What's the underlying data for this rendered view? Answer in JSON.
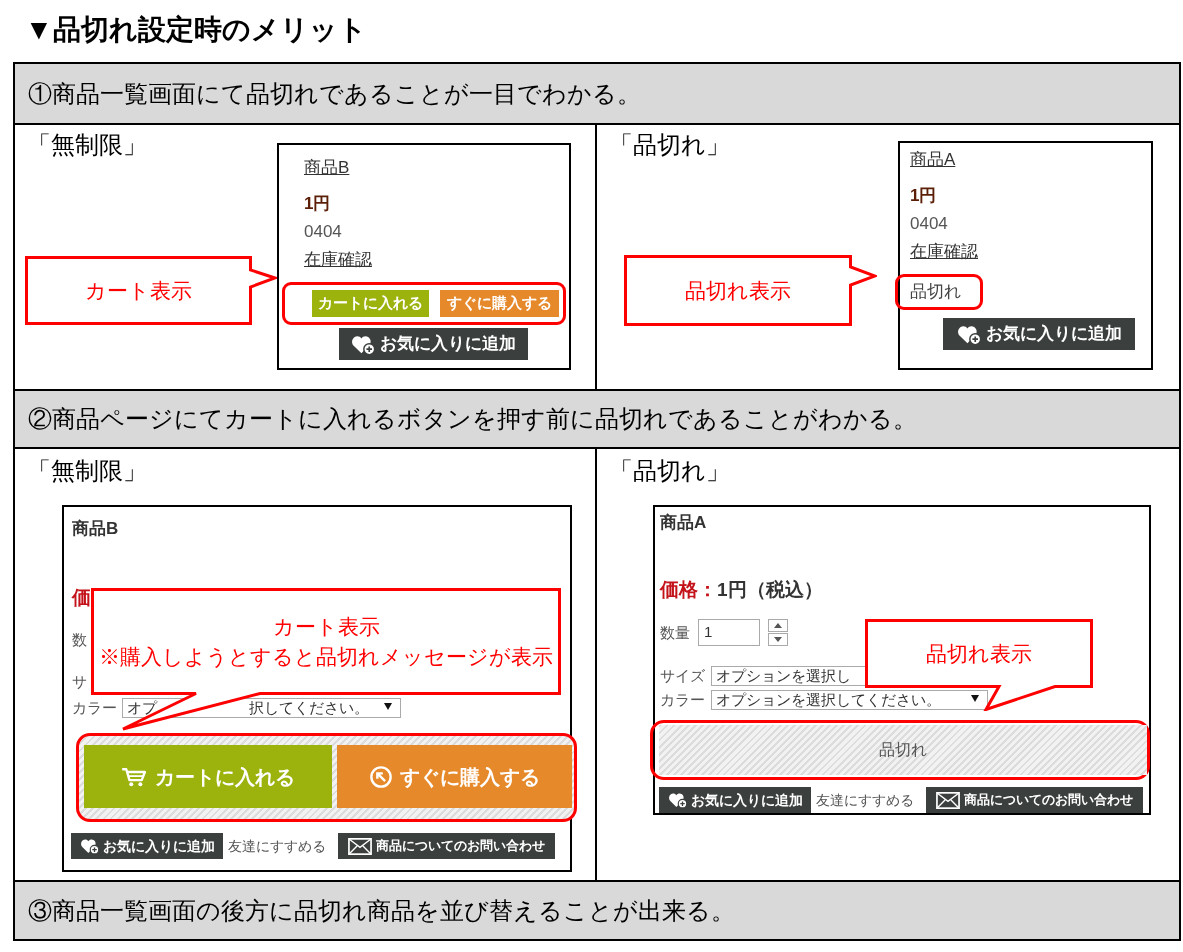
{
  "title": "▼品切れ設定時のメリット",
  "sections": [
    {
      "kind": "list_view",
      "heading": "①商品一覧画面にて品切れであることが一目でわかる。",
      "panels": [
        {
          "kind": "in_stock",
          "label": "「無制限」",
          "product": {
            "name": "商品B",
            "price": "1円",
            "code": "0404",
            "stock_link": "在庫確認",
            "cart_button": "カートに入れる",
            "buy_button": "すぐに購入する",
            "favorite_button": "お気に入りに追加"
          },
          "callout": [
            "カート表示"
          ]
        },
        {
          "kind": "sold_out",
          "label": "「品切れ」",
          "product": {
            "name": "商品A",
            "price": "1円",
            "code": "0404",
            "stock_link": "在庫確認",
            "sold_out": "品切れ",
            "favorite_button": "お気に入りに追加"
          },
          "callout": [
            "品切れ表示"
          ]
        }
      ]
    },
    {
      "kind": "product_page",
      "heading": "②商品ページにてカートに入れるボタンを押す前に品切れであることがわかる。",
      "panels": [
        {
          "kind": "in_stock",
          "label": "「無制限」",
          "product": {
            "name": "商品B",
            "price_label": "価",
            "quantity_label": "数",
            "size_label": "サ",
            "color_label": "カラー",
            "color_select": [
              "オプ",
              "択してください。"
            ],
            "cart_button": "カートに入れる",
            "buy_button": "すぐに購入する",
            "favorite_button": "お気に入りに追加",
            "recommend_link": "友達にすすめる",
            "inquiry_button": "商品についてのお問い合わせ"
          },
          "callout": [
            "カート表示",
            "※購入しようとすると品切れメッセージが表示"
          ]
        },
        {
          "kind": "sold_out",
          "label": "「品切れ」",
          "product": {
            "name": "商品A",
            "price_label": "価格：",
            "price_value": "1円（税込）",
            "quantity_label": "数量",
            "quantity_value": "1",
            "size_label": "サイズ",
            "size_select": [
              "オプションを選択し"
            ],
            "color_label": "カラー",
            "color_select": [
              "オプションを選択してください。"
            ],
            "sold_out": "品切れ",
            "favorite_button": "お気に入りに追加",
            "recommend_link": "友達にすすめる",
            "inquiry_button": "商品についてのお問い合わせ"
          },
          "callout": [
            "品切れ表示"
          ]
        }
      ]
    },
    {
      "kind": "note",
      "heading": "③商品一覧画面の後方に品切れ商品を並び替えることが出来る。"
    }
  ]
}
